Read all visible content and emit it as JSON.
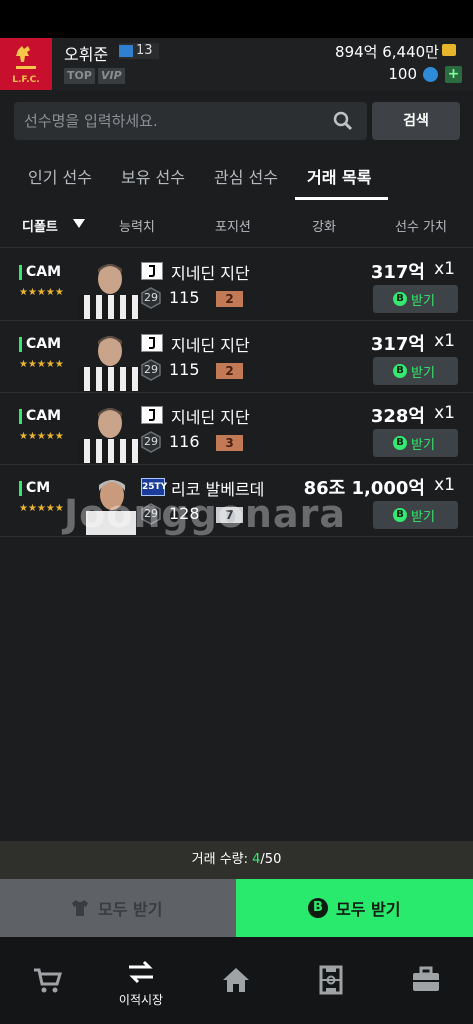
{
  "header": {
    "user_name": "오휘준",
    "level": "13",
    "rank_top": "TOP",
    "rank_vip": "VIP",
    "coins": "894억 6,440만",
    "points": "100"
  },
  "search": {
    "placeholder": "선수명을 입력하세요.",
    "button_label": "검색"
  },
  "tabs": [
    {
      "label": "인기 선수"
    },
    {
      "label": "보유 선수"
    },
    {
      "label": "관심 선수"
    },
    {
      "label": "거래 목록"
    }
  ],
  "filters": {
    "default": "디폴트",
    "ability": "능력치",
    "position": "포지션",
    "upgrade": "강화",
    "value": "선수 가치"
  },
  "players": [
    {
      "pos": "CAM",
      "stars": "★★★★★",
      "name": "지네딘 지단",
      "pay": "29",
      "ovr": "115",
      "grade": "2",
      "price": "317억",
      "qty": "x1",
      "receive": "받기",
      "accent": "#35e86f"
    },
    {
      "pos": "CAM",
      "stars": "★★★★★",
      "name": "지네딘 지단",
      "pay": "29",
      "ovr": "115",
      "grade": "2",
      "price": "317억",
      "qty": "x1",
      "receive": "받기",
      "accent": "#35e86f"
    },
    {
      "pos": "CAM",
      "stars": "★★★★★",
      "name": "지네딘 지단",
      "pay": "29",
      "ovr": "116",
      "grade": "3",
      "price": "328억",
      "qty": "x1",
      "receive": "받기",
      "accent": "#35e86f"
    },
    {
      "pos": "CM",
      "stars": "★★★★★",
      "name": "리코 발베르데",
      "pay": "29",
      "ovr": "128",
      "grade": "7",
      "price": "86조 1,000억",
      "qty": "x1",
      "receive": "받기",
      "season": "25TY",
      "accent": "#35e86f"
    }
  ],
  "watermark": "Joonggonara",
  "trade": {
    "prefix": "거래 수량: ",
    "current": "4",
    "suffix": "/50"
  },
  "actions": {
    "all_receive_gray": "모두 받기",
    "all_receive_green": "모두 받기"
  },
  "nav": [
    {
      "label": "",
      "icon": "cart-icon"
    },
    {
      "label": "이적시장",
      "icon": "transfer-icon"
    },
    {
      "label": "",
      "icon": "home-icon"
    },
    {
      "label": "",
      "icon": "pitch-icon"
    },
    {
      "label": "",
      "icon": "briefcase-icon"
    }
  ],
  "colors": {
    "accent_green": "#29ea6c",
    "bg": "#1b1d1f",
    "club": "#c8102e",
    "gold": "#e9b530"
  }
}
